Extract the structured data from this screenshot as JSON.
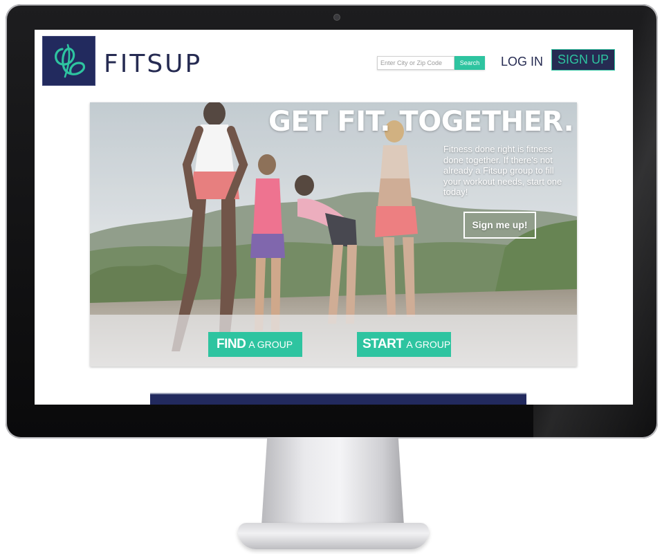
{
  "header": {
    "brand": "FITSUP",
    "search": {
      "placeholder": "Enter City or Zip Code",
      "button_label": "Search"
    },
    "login_label": "LOG IN",
    "signup_label": "SIGN UP"
  },
  "hero": {
    "title": "GET FIT. TOGETHER.",
    "body": "Fitness done right is fitness done together. If there's not already a Fitsup group to fill your workout needs, start one today!",
    "cta_label": "Sign me up!"
  },
  "actions": {
    "find": {
      "bold": "FIND",
      "light": "A GROUP"
    },
    "start": {
      "bold": "START",
      "light": "A GROUP"
    }
  },
  "colors": {
    "brand_navy": "#262b52",
    "accent_teal": "#2ec4a0",
    "bezel": "#111113"
  },
  "icons": {
    "logo": "fitsup-logo-icon",
    "camera": "webcam-icon"
  }
}
